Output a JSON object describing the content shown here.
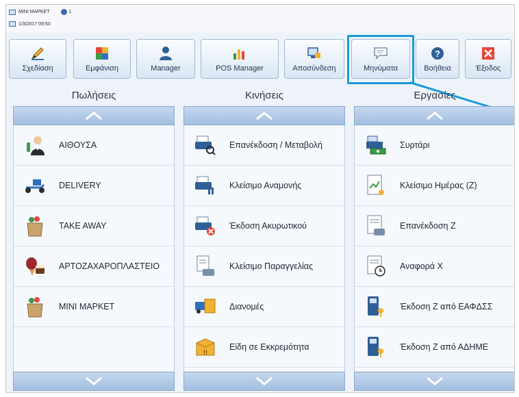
{
  "status": {
    "app_name": "MINI MAPKET",
    "user_count": "1",
    "datetime": "1/3/2017 09:50"
  },
  "toolbar": [
    {
      "label": "Σχεδίαση",
      "icon": "pencil-icon"
    },
    {
      "label": "Εμφάνιση",
      "icon": "palette-icon"
    },
    {
      "label": "Manager",
      "icon": "user-icon"
    },
    {
      "label": "POS Manager",
      "icon": "bar-chart-icon"
    },
    {
      "label": "Αποσύνδεση",
      "icon": "logout-icon"
    },
    {
      "label": "Μηνύματα",
      "icon": "message-icon"
    },
    {
      "label": "Βοήθεια",
      "icon": "help-icon"
    },
    {
      "label": "Έξοδος",
      "icon": "close-icon"
    }
  ],
  "columns": [
    {
      "title": "Πωλήσεις",
      "items": [
        {
          "label": "ΑΙΘΟΥΣΑ",
          "icon": "waiter-icon"
        },
        {
          "label": "DELIVERY",
          "icon": "scooter-icon"
        },
        {
          "label": "TAKE AWAY",
          "icon": "grocery-bag-icon"
        },
        {
          "label": "ΑΡΤΟΖΑΧΑΡΟΠΛΑΣΤΕΙΟ",
          "icon": "pastry-icon"
        },
        {
          "label": "MINI MAPKET",
          "icon": "grocery-bag-icon"
        }
      ]
    },
    {
      "title": "Κινήσεις",
      "items": [
        {
          "label": "Επανέκδοση / Μεταβολή",
          "icon": "printer-search-icon"
        },
        {
          "label": "Κλείσιμο Αναμονής",
          "icon": "printer-pause-icon"
        },
        {
          "label": "Έκδοση Ακυρωτικού",
          "icon": "printer-cancel-icon"
        },
        {
          "label": "Κλείσιμο Παραγγελίας",
          "icon": "document-printer-icon"
        },
        {
          "label": "Διανομές",
          "icon": "delivery-truck-icon"
        },
        {
          "label": "Είδη σε Εκκρεμότητα",
          "icon": "pending-box-icon"
        }
      ]
    },
    {
      "title": "Εργασίες",
      "items": [
        {
          "label": "Συρτάρι",
          "icon": "cash-register-icon"
        },
        {
          "label": "Κλείσιμο Ημέρας (Z)",
          "icon": "report-chart-icon"
        },
        {
          "label": "Επανέκδοση Ζ",
          "icon": "report-reprint-icon"
        },
        {
          "label": "Αναφορά Χ",
          "icon": "report-clock-icon"
        },
        {
          "label": "Έκδοση Ζ από ΕΑΦΔΣΣ",
          "icon": "device-key-icon"
        },
        {
          "label": "Έκδοση Ζ από ΑΔΗΜΕ",
          "icon": "device-key-icon"
        }
      ]
    }
  ]
}
